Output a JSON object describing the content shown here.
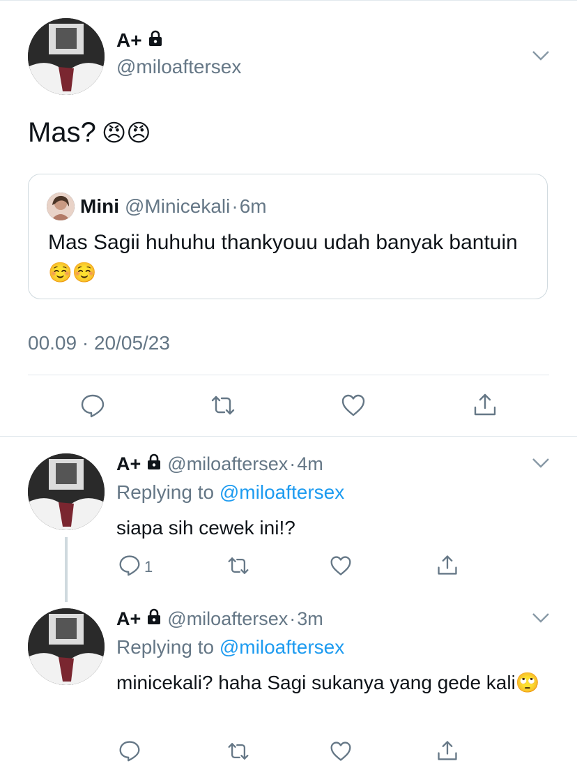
{
  "tweet": {
    "name": "A+",
    "handle": "@miloaftersex",
    "text": "Mas?",
    "emojis": "😠😠",
    "quote": {
      "name": "Mini",
      "handle": "@Minicekali",
      "separator": "·",
      "age": "6m",
      "text": "Mas Sagii huhuhu thankyouu udah banyak bantuin",
      "emojis": "☺️☺️"
    },
    "timestamp": "00.09 · 20/05/23",
    "actions": [
      "reply-icon",
      "retweet-icon",
      "like-icon",
      "share-icon"
    ]
  },
  "replies": [
    {
      "name": "A+",
      "handle": "@miloaftersex",
      "separator": "·",
      "age": "4m",
      "replying_prefix": "Replying to",
      "replying_to": "@miloaftersex",
      "text": "siapa sih cewek ini!?",
      "reply_count": "1"
    },
    {
      "name": "A+",
      "handle": "@miloaftersex",
      "separator": "·",
      "age": "3m",
      "replying_prefix": "Replying to",
      "replying_to": "@miloaftersex",
      "text": "minicekali? haha Sagi sukanya yang gede kali",
      "emoji": "🙄"
    }
  ],
  "colors": {
    "muted": "#657786",
    "link": "#1d9bf0",
    "border": "#cfd9de"
  }
}
